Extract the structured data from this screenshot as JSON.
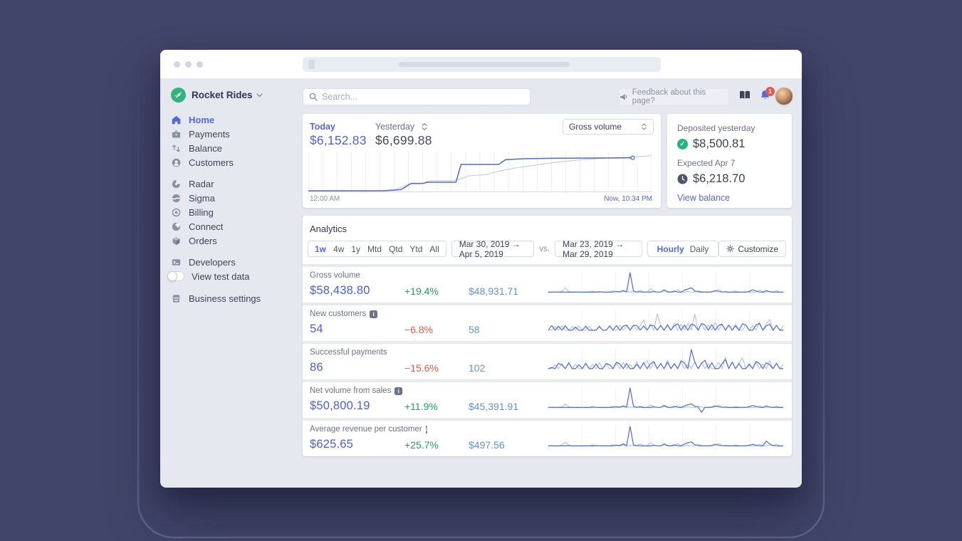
{
  "colors": {
    "background": "#414569",
    "accent": "#5469d4",
    "value_blue": "#4d5fd3",
    "positive_green": "#22a06a",
    "negative_orange": "#e65a3e",
    "compare_blue": "#5f93dd",
    "logo_green": "#2eb47c",
    "deposit_green": "#24b47e",
    "badge_red": "#e25950",
    "spark_current": "#5469d4",
    "spark_previous": "#9ec1ec",
    "yesterday_line": "#c7cfdf"
  },
  "sidebar": {
    "account_name": "Rocket Rides",
    "main": [
      {
        "label": "Home",
        "active": true
      },
      {
        "label": "Payments",
        "active": false
      },
      {
        "label": "Balance",
        "active": false
      },
      {
        "label": "Customers",
        "active": false
      }
    ],
    "products": [
      {
        "label": "Radar"
      },
      {
        "label": "Sigma"
      },
      {
        "label": "Billing"
      },
      {
        "label": "Connect"
      },
      {
        "label": "Orders"
      }
    ],
    "developers": {
      "label": "Developers"
    },
    "test_data": {
      "label": "View test data",
      "enabled": false
    },
    "settings": {
      "label": "Business settings"
    }
  },
  "header": {
    "search_placeholder": "Search...",
    "feedback_label": "Feedback about this page?",
    "notification_count": "1"
  },
  "overview": {
    "today_label": "Today",
    "today_value": "$6,152.83",
    "yesterday_label": "Yesterday",
    "yesterday_value": "$6,699.88",
    "metric_select_value": "Gross volume",
    "x_start": "12:00 AM",
    "x_end": "Now, 10:34 PM"
  },
  "deposits": {
    "deposited_label": "Deposited yesterday",
    "deposited_value": "$8,500.81",
    "expected_label": "Expected Apr 7",
    "expected_value": "$6,218.70",
    "link_label": "View balance"
  },
  "analytics": {
    "title": "Analytics",
    "ranges": {
      "options": [
        "1w",
        "4w",
        "1y",
        "Mtd",
        "Qtd",
        "Ytd",
        "All"
      ],
      "active": "1w"
    },
    "date_range": "Mar 30, 2019 → Apr 5, 2019",
    "vs_label": "vs.",
    "compare_range": "Mar 23, 2019 → Mar 29, 2019",
    "granularity": {
      "options": [
        "Hourly",
        "Daily"
      ],
      "active": "Hourly"
    },
    "customize_label": "Customize",
    "rows": [
      {
        "label": "Gross volume",
        "info": false,
        "value": "$58,438.80",
        "delta": "+19.4%",
        "delta_dir": "up",
        "compare": "$48,931.71"
      },
      {
        "label": "New customers",
        "info": true,
        "value": "54",
        "delta": "−6.8%",
        "delta_dir": "down",
        "compare": "58"
      },
      {
        "label": "Successful payments",
        "info": false,
        "value": "86",
        "delta": "−15.6%",
        "delta_dir": "down",
        "compare": "102"
      },
      {
        "label": "Net volume from sales",
        "info": true,
        "value": "$50,800.19",
        "delta": "+11.9%",
        "delta_dir": "up",
        "compare": "$45,391.91"
      },
      {
        "label": "Average revenue per customer",
        "info": true,
        "value": "$625.65",
        "delta": "+25.7%",
        "delta_dir": "up",
        "compare": "$497.56"
      }
    ]
  },
  "chart_data": {
    "overview": {
      "type": "line",
      "note": "cumulative gross volume, points are [fraction_of_day, fraction_of_max]",
      "x_start": "12:00 AM",
      "x_end": "Now, 10:34 PM",
      "hour_gridlines": 24,
      "series": [
        {
          "name": "Today",
          "total": "$6,152.83",
          "points": [
            [
              0,
              0.02
            ],
            [
              0.215,
              0.02
            ],
            [
              0.27,
              0.05
            ],
            [
              0.3,
              0.22
            ],
            [
              0.335,
              0.22
            ],
            [
              0.345,
              0.25
            ],
            [
              0.43,
              0.25
            ],
            [
              0.445,
              0.73
            ],
            [
              0.555,
              0.73
            ],
            [
              0.575,
              0.86
            ],
            [
              0.63,
              0.885
            ],
            [
              0.72,
              0.9
            ],
            [
              0.945,
              0.91
            ]
          ],
          "end_marker": true
        },
        {
          "name": "Yesterday",
          "total": "$6,699.88",
          "points": [
            [
              0,
              0.02
            ],
            [
              0.245,
              0.02
            ],
            [
              0.295,
              0.21
            ],
            [
              0.33,
              0.21
            ],
            [
              0.355,
              0.29
            ],
            [
              0.42,
              0.29
            ],
            [
              0.445,
              0.34
            ],
            [
              0.465,
              0.42
            ],
            [
              0.52,
              0.46
            ],
            [
              0.555,
              0.55
            ],
            [
              0.6,
              0.63
            ],
            [
              0.66,
              0.71
            ],
            [
              0.72,
              0.79
            ],
            [
              0.8,
              0.86
            ],
            [
              0.88,
              0.91
            ],
            [
              0.95,
              0.935
            ],
            [
              1.0,
              0.965
            ]
          ],
          "end_marker": false
        }
      ]
    },
    "sparklines": [
      {
        "name": "Gross volume",
        "current": [
          2,
          2,
          3,
          2,
          2,
          3,
          2,
          2,
          3,
          2,
          2,
          2,
          3,
          2,
          2,
          4,
          3,
          2,
          2,
          3,
          6,
          4,
          10,
          4,
          100,
          8,
          3,
          4,
          2,
          3,
          2,
          5,
          3,
          2,
          14,
          4,
          2,
          8,
          3,
          2,
          12,
          18,
          24,
          8,
          4,
          2,
          3,
          2,
          4,
          10,
          6,
          3,
          4,
          2,
          3,
          2,
          2,
          3,
          2,
          6,
          14,
          8,
          3,
          2,
          10,
          4,
          2,
          3,
          2,
          2
        ],
        "previous": [
          2,
          3,
          2,
          2,
          6,
          24,
          6,
          2,
          3,
          2,
          2,
          3,
          2,
          8,
          3,
          2,
          3,
          2,
          2,
          10,
          3,
          2,
          6,
          3,
          4,
          3,
          2,
          12,
          3,
          2,
          20,
          6,
          2,
          3,
          8,
          2,
          3,
          2,
          14,
          3,
          2,
          6,
          3,
          2,
          10,
          4,
          2,
          3,
          2,
          6,
          16,
          4,
          2,
          3,
          2,
          8,
          3,
          2,
          4,
          2,
          3,
          2,
          12,
          3,
          2,
          6,
          3,
          10,
          3,
          2
        ]
      },
      {
        "name": "New customers",
        "current": [
          4,
          28,
          4,
          24,
          4,
          26,
          4,
          4,
          20,
          4,
          4,
          24,
          4,
          4,
          4,
          22,
          4,
          4,
          26,
          4,
          28,
          4,
          24,
          30,
          4,
          28,
          28,
          4,
          26,
          4,
          30,
          26,
          4,
          28,
          4,
          32,
          4,
          26,
          36,
          4,
          30,
          4,
          34,
          28,
          4,
          38,
          30,
          4,
          32,
          4,
          28,
          34,
          4,
          30,
          4,
          26,
          4,
          36,
          30,
          4,
          4,
          30,
          38,
          4,
          26,
          34,
          4,
          28,
          4,
          4
        ],
        "previous": [
          4,
          4,
          22,
          4,
          26,
          4,
          4,
          24,
          4,
          26,
          4,
          4,
          22,
          4,
          4,
          26,
          4,
          4,
          24,
          4,
          4,
          30,
          4,
          26,
          4,
          32,
          4,
          28,
          56,
          4,
          34,
          4,
          85,
          30,
          4,
          28,
          4,
          40,
          4,
          32,
          4,
          38,
          4,
          85,
          4,
          36,
          4,
          30,
          4,
          42,
          4,
          34,
          4,
          28,
          4,
          36,
          4,
          4,
          32,
          4,
          28,
          4,
          44,
          4,
          36,
          58,
          4,
          30,
          4,
          26
        ]
      },
      {
        "name": "Successful payments",
        "current": [
          4,
          10,
          4,
          30,
          24,
          4,
          34,
          4,
          4,
          24,
          4,
          30,
          4,
          4,
          28,
          4,
          4,
          30,
          24,
          4,
          36,
          28,
          4,
          30,
          4,
          4,
          26,
          4,
          34,
          4,
          28,
          40,
          4,
          30,
          4,
          36,
          4,
          28,
          4,
          44,
          32,
          4,
          100,
          36,
          4,
          30,
          46,
          4,
          34,
          4,
          4,
          28,
          50,
          4,
          36,
          4,
          30,
          4,
          4,
          26,
          4,
          40,
          30,
          4,
          34,
          24,
          4,
          30,
          4,
          4
        ],
        "previous": [
          4,
          4,
          24,
          4,
          28,
          4,
          30,
          4,
          26,
          4,
          4,
          32,
          4,
          26,
          4,
          34,
          4,
          28,
          4,
          4,
          30,
          4,
          36,
          4,
          28,
          4,
          38,
          4,
          30,
          44,
          4,
          34,
          4,
          28,
          4,
          46,
          4,
          32,
          4,
          36,
          4,
          28,
          4,
          40,
          4,
          34,
          4,
          30,
          4,
          4,
          36,
          4,
          60,
          4,
          40,
          4,
          34,
          58,
          4,
          30,
          4,
          36,
          4,
          28,
          4,
          44,
          4,
          32,
          4,
          26
        ]
      },
      {
        "name": "Net volume from sales",
        "current": [
          3,
          2,
          3,
          2,
          2,
          3,
          2,
          3,
          2,
          2,
          3,
          2,
          2,
          4,
          3,
          2,
          3,
          2,
          2,
          3,
          6,
          4,
          10,
          4,
          100,
          8,
          3,
          4,
          2,
          3,
          2,
          5,
          3,
          2,
          12,
          4,
          2,
          8,
          3,
          2,
          10,
          16,
          20,
          8,
          4,
          -22,
          3,
          2,
          4,
          10,
          6,
          3,
          4,
          2,
          3,
          2,
          2,
          3,
          2,
          6,
          12,
          8,
          3,
          2,
          10,
          4,
          2,
          3,
          2,
          2
        ],
        "previous": [
          2,
          3,
          2,
          2,
          5,
          20,
          5,
          2,
          3,
          2,
          2,
          3,
          2,
          7,
          3,
          2,
          3,
          2,
          2,
          9,
          3,
          2,
          5,
          3,
          4,
          3,
          2,
          10,
          3,
          2,
          16,
          5,
          2,
          3,
          7,
          2,
          3,
          2,
          12,
          3,
          2,
          5,
          3,
          2,
          9,
          4,
          2,
          3,
          2,
          5,
          14,
          4,
          2,
          3,
          2,
          7,
          3,
          2,
          4,
          2,
          3,
          2,
          10,
          3,
          2,
          5,
          3,
          9,
          3,
          2
        ]
      },
      {
        "name": "Average revenue per customer",
        "current": [
          2,
          3,
          2,
          2,
          3,
          2,
          4,
          2,
          3,
          2,
          2,
          3,
          2,
          2,
          4,
          3,
          2,
          3,
          2,
          2,
          6,
          4,
          12,
          4,
          100,
          8,
          4,
          3,
          2,
          3,
          2,
          5,
          3,
          2,
          12,
          4,
          2,
          8,
          3,
          2,
          12,
          18,
          22,
          8,
          4,
          2,
          3,
          2,
          4,
          10,
          6,
          3,
          4,
          2,
          3,
          2,
          2,
          3,
          2,
          6,
          10,
          6,
          3,
          2,
          26,
          12,
          4,
          3,
          2,
          2
        ],
        "previous": [
          2,
          3,
          2,
          2,
          6,
          22,
          6,
          2,
          3,
          2,
          2,
          3,
          2,
          8,
          3,
          2,
          3,
          2,
          2,
          10,
          3,
          2,
          6,
          3,
          4,
          3,
          2,
          12,
          3,
          2,
          18,
          6,
          2,
          3,
          8,
          2,
          3,
          2,
          13,
          3,
          2,
          6,
          3,
          2,
          10,
          4,
          2,
          3,
          2,
          6,
          15,
          4,
          2,
          3,
          2,
          8,
          3,
          2,
          4,
          2,
          3,
          2,
          11,
          3,
          2,
          6,
          3,
          10,
          3,
          2
        ]
      }
    ]
  }
}
